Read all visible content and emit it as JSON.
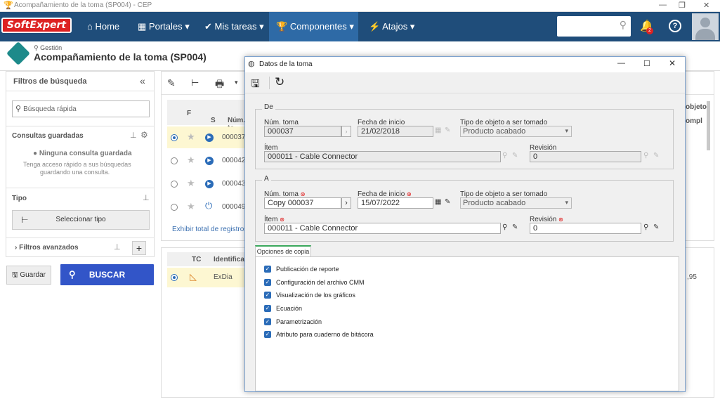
{
  "window": {
    "title": "Acompañamiento de la toma (SP004) - CEP"
  },
  "nav": {
    "logo": "SoftExpert",
    "items": [
      "Home",
      "Portales",
      "Mis tareas",
      "Componentes",
      "Atajos"
    ],
    "notification_count": "2"
  },
  "header": {
    "breadcrumb": "Gestión",
    "title": "Acompañamiento de la toma (SP004)"
  },
  "left_panel": {
    "title": "Filtros de búsqueda",
    "search_placeholder": "Búsqueda rápida",
    "saved_queries": "Consultas guardadas",
    "no_saved": "Ninguna consulta guardada",
    "no_saved_hint_1": "Tenga acceso rápido a sus búsquedas",
    "no_saved_hint_2": "guardando una consulta.",
    "type_label": "Tipo",
    "select_type": "Seleccionar tipo",
    "advanced_filters": "Filtros avanzados",
    "save_label": "Guardar",
    "search_label": "BUSCAR"
  },
  "grid": {
    "col_f": "F",
    "col_s": "S",
    "col_num": "Núm. to",
    "rows": [
      "000037",
      "000042",
      "000043",
      "000049"
    ],
    "footer": "Exhibir total de registros",
    "right_col_1": "objeto",
    "right_col_2": "ompl"
  },
  "grid2": {
    "col_tc": "TC",
    "col_id": "Identificac",
    "row_id": "ExDia",
    "right_value": ",95"
  },
  "dialog": {
    "title": "Datos de la toma",
    "de": {
      "legend": "De",
      "num_label": "Núm. toma",
      "num_value": "000037",
      "date_label": "Fecha de inicio",
      "date_value": "21/02/2018",
      "type_label": "Tipo de objeto a ser tomado",
      "type_value": "Producto acabado",
      "item_label": "Ítem",
      "item_value": "000011 - Cable Connector",
      "rev_label": "Revisión",
      "rev_value": "0"
    },
    "a": {
      "legend": "A",
      "num_label": "Núm. toma",
      "num_value": "Copy 000037",
      "date_label": "Fecha de inicio",
      "date_value": "15/07/2022",
      "type_label": "Tipo de objeto a ser tomado",
      "type_value": "Producto acabado",
      "item_label": "Ítem",
      "item_value": "000011 - Cable Connector",
      "rev_label": "Revisión",
      "rev_value": "0"
    },
    "copy_tab": "Opciones de copia",
    "options": [
      "Publicación de reporte",
      "Configuración del archivo CMM",
      "Visualización de los gráficos",
      "Ecuación",
      "Parametrización",
      "Atributo para cuaderno de bitácora"
    ]
  }
}
